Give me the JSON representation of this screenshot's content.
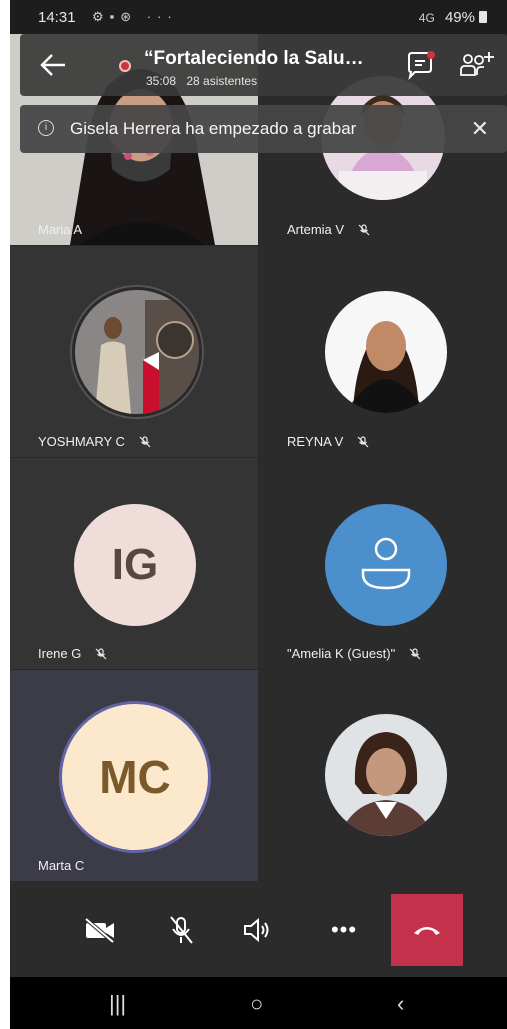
{
  "status_bar": {
    "time": "14:31",
    "signal": "4G",
    "battery": "49%"
  },
  "meeting": {
    "title": "“Fortaleciendo la Salu…",
    "duration": "35:08",
    "attendees": "28 asistentes",
    "recording_color": "#d13438"
  },
  "banner": {
    "text": "Gisela Herrera ha empezado a grabar"
  },
  "participants": [
    {
      "name": "Maria A",
      "muted": false
    },
    {
      "name": "Artemia V",
      "muted": true
    },
    {
      "name": "YOSHMARY C",
      "muted": true
    },
    {
      "name": "REYNA V",
      "muted": true
    },
    {
      "name": "Irene G",
      "muted": true,
      "initials": "IG"
    },
    {
      "name": "\"Amelia K (Guest)\"",
      "muted": true
    },
    {
      "name": "Marta C",
      "muted": false,
      "initials": "MC"
    },
    {
      "name": "",
      "muted": false
    }
  ],
  "controls": [
    "camera-off",
    "mic-off",
    "speaker",
    "more",
    "hang-up"
  ],
  "colors": {
    "hangup": "#c4314b",
    "guest_avatar": "#4c8fcd",
    "mc_avatar": "#fbe8cd",
    "ig_avatar": "#eeddd8"
  }
}
